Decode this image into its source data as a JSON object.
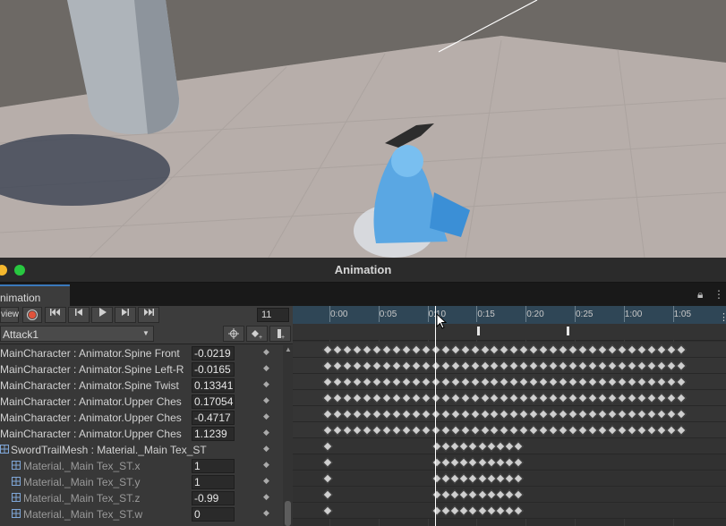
{
  "window": {
    "title": "Animation"
  },
  "tab": {
    "label": "nimation"
  },
  "toolbar": {
    "preview_label": "view",
    "frame_value": "11",
    "clip_name": "Attack1"
  },
  "timeline": {
    "ticks": [
      "0:00",
      "0:05",
      "0:10",
      "0:15",
      "0:20",
      "0:25",
      "1:00",
      "1:05"
    ]
  },
  "properties": [
    {
      "label": "MainCharacter : Animator.Spine Front",
      "value": "-0.0219"
    },
    {
      "label": "MainCharacter : Animator.Spine Left-R",
      "value": "-0.0165"
    },
    {
      "label": "MainCharacter : Animator.Spine Twist",
      "value": "0.13341"
    },
    {
      "label": "MainCharacter : Animator.Upper Ches",
      "value": "0.17054"
    },
    {
      "label": "MainCharacter : Animator.Upper Ches",
      "value": "-0.4717"
    },
    {
      "label": "MainCharacter : Animator.Upper Ches",
      "value": "1.1239"
    }
  ],
  "group": {
    "label": "SwordTrailMesh : Material._Main Tex_ST"
  },
  "sub_properties": [
    {
      "label": "Material._Main Tex_ST.x",
      "value": "1"
    },
    {
      "label": "Material._Main Tex_ST.y",
      "value": "1"
    },
    {
      "label": "Material._Main Tex_ST.z",
      "value": "-0.99"
    },
    {
      "label": "Material._Main Tex_ST.w",
      "value": "0"
    }
  ],
  "colors": {
    "accent": "#3a79bb",
    "record": "#e0533c",
    "timeline_bar": "#2f4656",
    "playhead": "#ffffff"
  },
  "icons": [
    "record-icon",
    "first-key-icon",
    "prev-key-icon",
    "play-icon",
    "next-key-icon",
    "last-key-icon",
    "add-event-icon",
    "add-keyframe-icon",
    "lock-icon",
    "more-icon"
  ]
}
